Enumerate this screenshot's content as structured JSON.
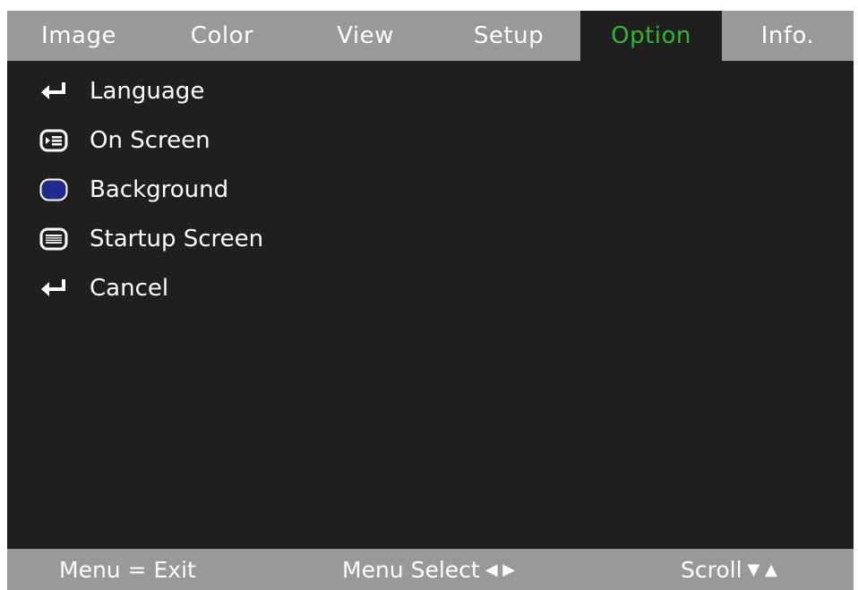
{
  "tabs": [
    {
      "label": "Image",
      "active": false
    },
    {
      "label": "Color",
      "active": false
    },
    {
      "label": "View",
      "active": false
    },
    {
      "label": "Setup",
      "active": false
    },
    {
      "label": "Option",
      "active": true
    },
    {
      "label": "Info.",
      "active": false
    }
  ],
  "menu": {
    "items": [
      {
        "label": "Language",
        "icon": "enter-arrow-icon"
      },
      {
        "label": "On Screen",
        "icon": "on-screen-icon"
      },
      {
        "label": "Background",
        "icon": "background-color-icon"
      },
      {
        "label": "Startup Screen",
        "icon": "ibm-logo-icon"
      },
      {
        "label": "Cancel",
        "icon": "enter-arrow-icon"
      }
    ]
  },
  "status": {
    "exit": "Menu = Exit",
    "select": "Menu Select",
    "select_arrows": "◀ ▶",
    "scroll": "Scroll",
    "scroll_arrows": "▼ ▲"
  },
  "colors": {
    "active_tab_text": "#2eb82e",
    "bar_background": "#999999",
    "panel_background": "#201e1f",
    "background_swatch": "#1f2b8f"
  }
}
